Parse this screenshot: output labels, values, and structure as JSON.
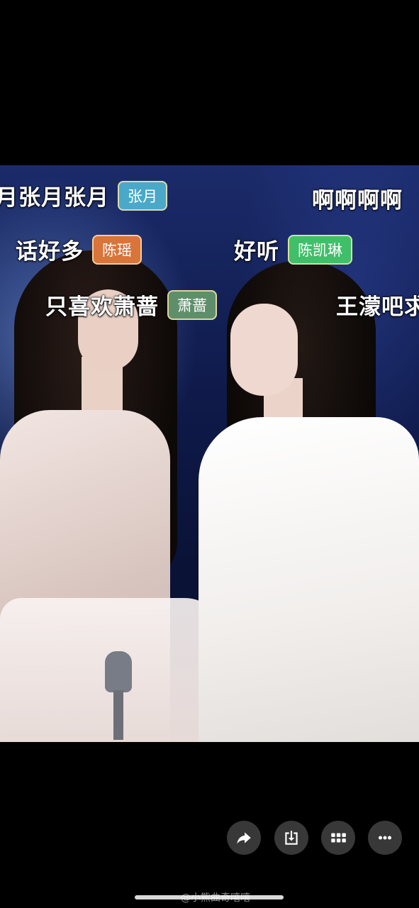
{
  "danmaku": [
    {
      "text": "月张月张月",
      "badge": "张月",
      "badge_color": "#4aa8c9"
    },
    {
      "text": "啊啊啊啊"
    },
    {
      "text": "话好多",
      "badge": "陈瑶",
      "badge_color": "#d9743a"
    },
    {
      "text": "好听",
      "badge": "陈凯琳",
      "badge_color": "#3fbf6a"
    },
    {
      "text": "只喜欢萧蔷",
      "badge": "萧蔷",
      "badge_color": "#5f8f6a"
    },
    {
      "text": "王濛吧求"
    }
  ],
  "actions": {
    "share": "share-icon",
    "download": "download-icon",
    "grid": "grid-icon",
    "more": "more-icon"
  },
  "watermark": "@小熊曲奇嘻嘻"
}
